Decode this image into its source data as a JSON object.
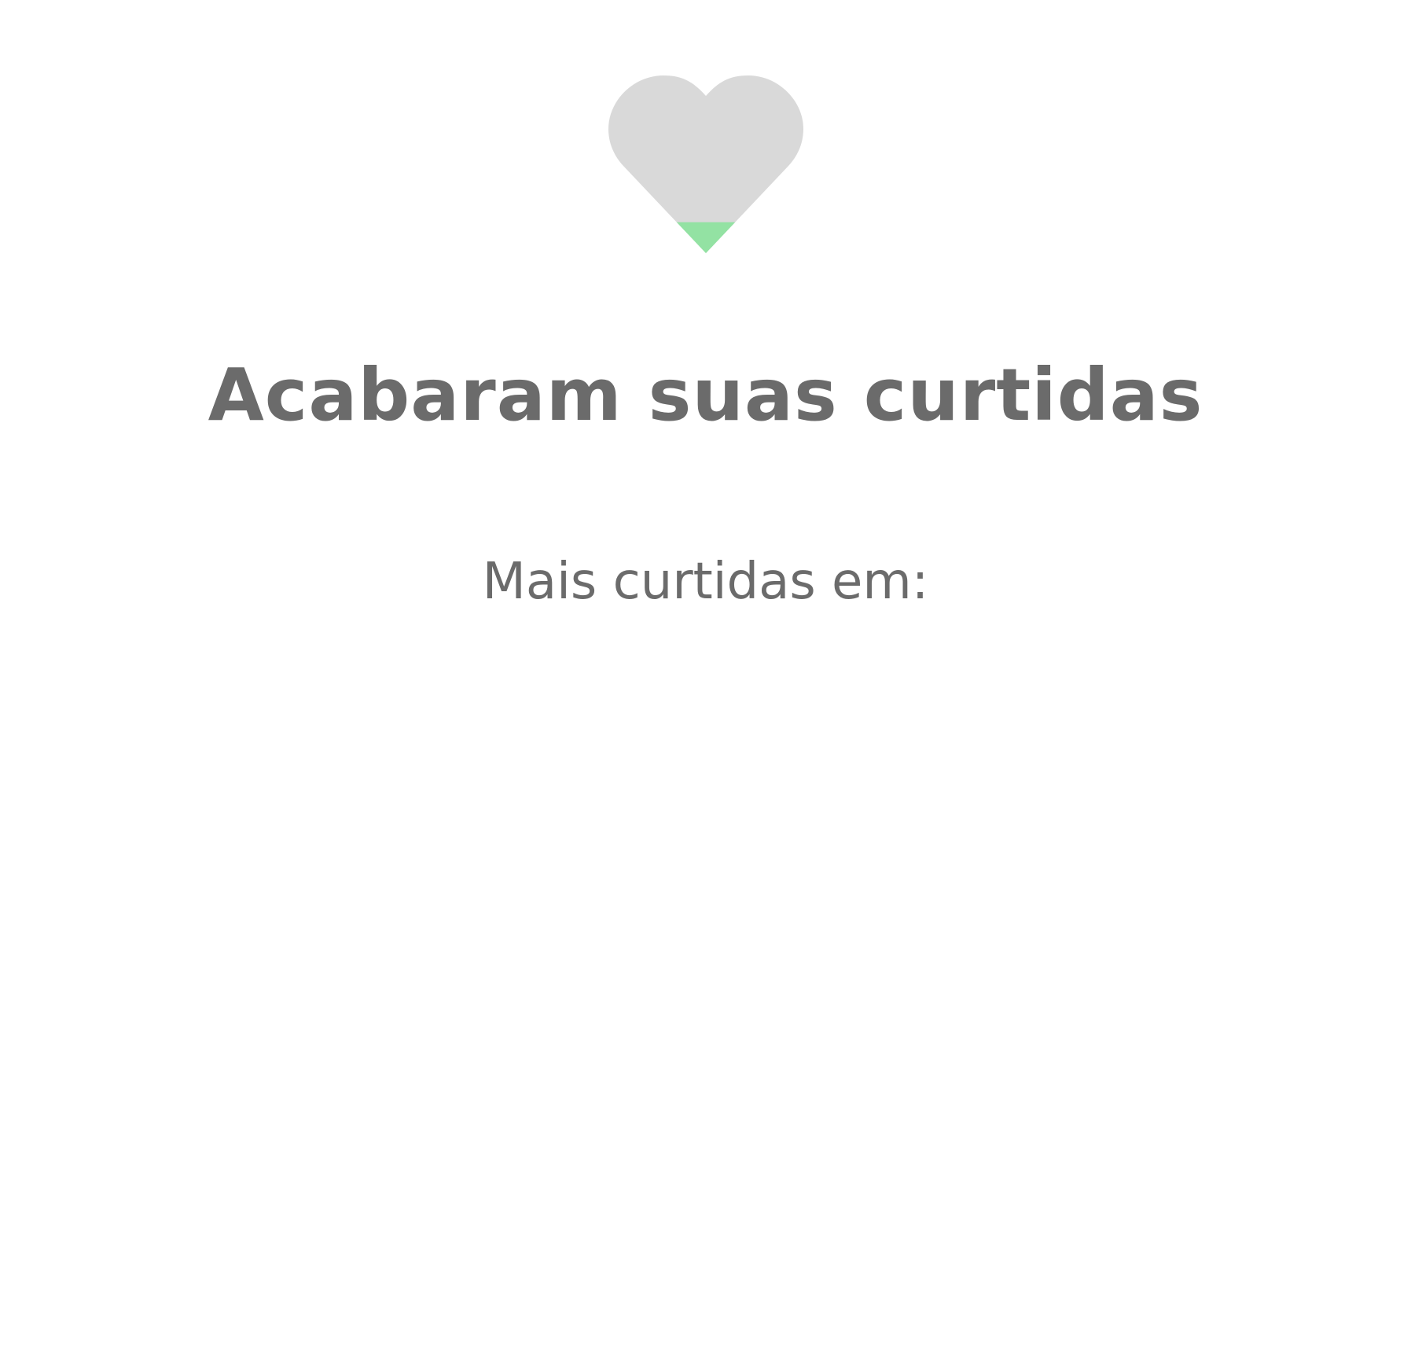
{
  "likes_empty": {
    "icon": "heart-icon",
    "heart_fill_fraction": 0.18,
    "colors": {
      "heart_empty": "#d9d9d9",
      "heart_fill": "#93e2a3",
      "text": "#6b6b6b",
      "background": "#ffffff"
    },
    "title": "Acabaram suas curtidas",
    "subtitle": "Mais curtidas em:",
    "countdown": ""
  }
}
